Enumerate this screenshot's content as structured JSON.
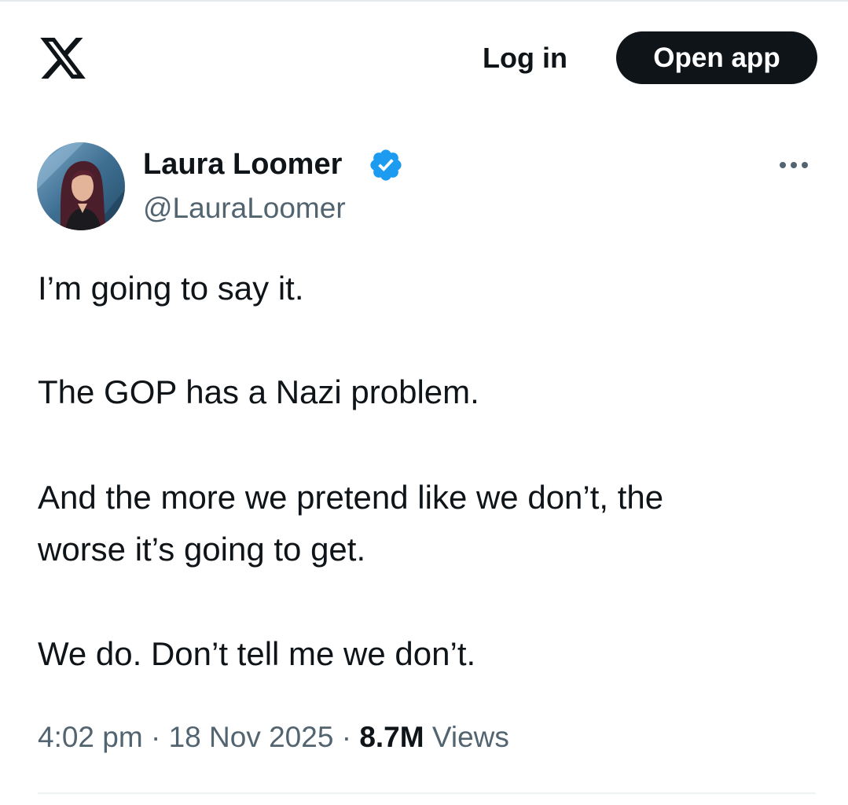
{
  "header": {
    "logo_icon": "x-logo-icon",
    "login_label": "Log in",
    "open_app_label": "Open app"
  },
  "author": {
    "display_name": "Laura Loomer",
    "handle": "@LauraLoomer",
    "verified": true,
    "verified_color": "#1d9bf0",
    "avatar_icon": "profile-photo"
  },
  "tweet": {
    "lines": [
      "I’m going to say it.",
      "The GOP has a Nazi problem.",
      "And the more we pretend like we don’t, the",
      "worse it’s going to get.",
      "We do. Don’t tell me we don’t."
    ]
  },
  "meta": {
    "time": "4:02 pm",
    "separator": " · ",
    "date": "18 Nov 2025",
    "views_count": "8.7M",
    "views_label": "Views"
  },
  "colors": {
    "text_primary": "#0f1419",
    "text_secondary": "#536471",
    "button_bg": "#0f1419",
    "divider": "#eff3f4"
  }
}
